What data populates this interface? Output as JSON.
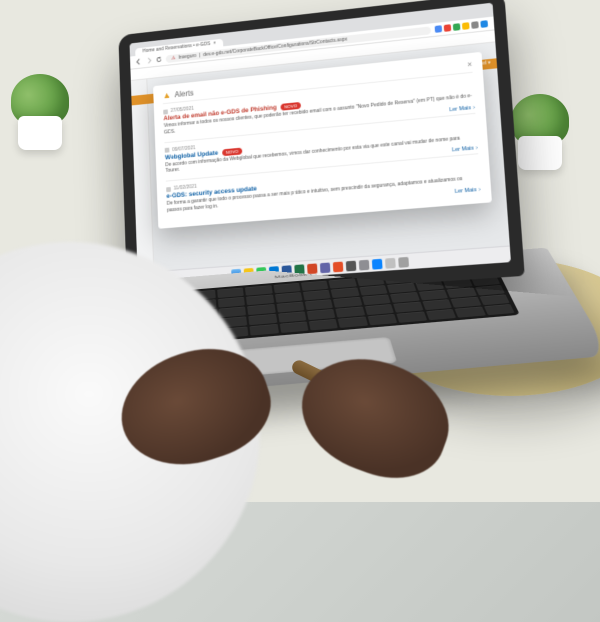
{
  "browser": {
    "tab_title": "Home and Reservations • e-GDS",
    "url_security": "Inseguro",
    "url": "dev.e-gds.net/CorporateBackOffice/Configurations/StrContacts.aspx"
  },
  "dock_label": "MacBook Pro",
  "app": {
    "ribbon_text": "Seleccionar hotel ▾"
  },
  "modal": {
    "title": "Alerts",
    "close": "×",
    "read_more": "Ler Mais",
    "items": [
      {
        "date": "27/05/2021",
        "title": "Alerta de email não e-GDS de Phishing",
        "title_color": "red",
        "badge": "NOVO",
        "body": "Vimos informar a todos os nossos clientes, que poderão ter recebido email com o assunto \"Novo Pedido de Reserva\" (em PT) que não é do e-GDS."
      },
      {
        "date": "09/07/2021",
        "title": "Webglobal Update",
        "title_color": "blue",
        "badge": "NOVO",
        "body": "De acordo com informação da Webglobal que recebemos, vimos dar conhecimento por esta via que este canal vai mudar de nome para Tourer."
      },
      {
        "date": "11/02/2021",
        "title": "e-GDS: security access update",
        "title_color": "blue",
        "badge": "",
        "body": "De forma a garantir que todo o processo passa a ser mais prático e intuitivo, sem prescindir da segurança, adaptamos e atualizamos os passos para fazer log in."
      }
    ]
  },
  "colors": {
    "accent_orange": "#e3942a",
    "link_blue": "#0c5fa5",
    "danger_red": "#c0392b",
    "badge_red": "#d9362e"
  }
}
